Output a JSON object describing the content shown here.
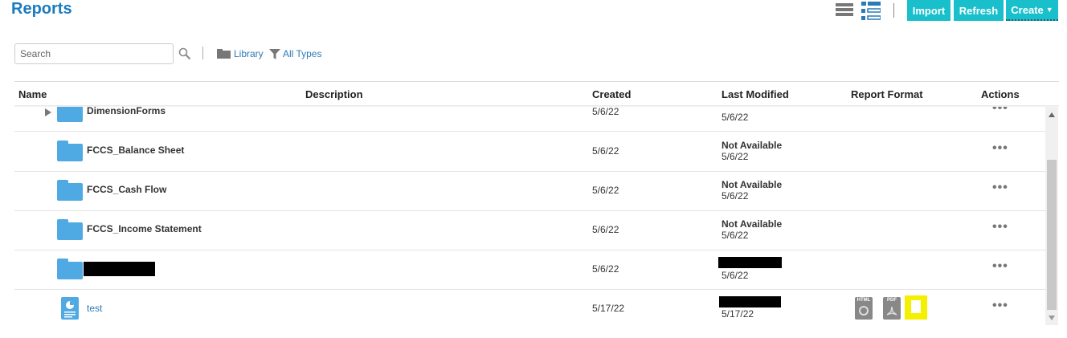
{
  "header": {
    "title": "Reports",
    "import_label": "Import",
    "refresh_label": "Refresh",
    "create_label": "Create",
    "accent": "#19c0cc"
  },
  "toolbar": {
    "search_placeholder": "Search",
    "library_label": "Library",
    "types_label": "All Types"
  },
  "columns": [
    "Name",
    "Description",
    "Created",
    "Last Modified",
    "Report Format",
    "Actions"
  ],
  "rows": [
    {
      "name": "DimensionForms",
      "created": "5/6/22",
      "modified_by": "",
      "modified_date": "5/6/22",
      "actions": "•••"
    },
    {
      "name": "FCCS_Balance Sheet",
      "created": "5/6/22",
      "modified_by": "Not Available",
      "modified_date": "5/6/22",
      "actions": "•••"
    },
    {
      "name": "FCCS_Cash Flow",
      "created": "5/6/22",
      "modified_by": "Not Available",
      "modified_date": "5/6/22",
      "actions": "•••"
    },
    {
      "name": "FCCS_Income Statement",
      "created": "5/6/22",
      "modified_by": "Not Available",
      "modified_date": "5/6/22",
      "actions": "•••"
    },
    {
      "name": "",
      "created": "5/6/22",
      "modified_by": "",
      "modified_date": "5/6/22",
      "actions": "•••"
    },
    {
      "name": "test",
      "created": "5/17/22",
      "modified_by": "",
      "modified_date": "5/17/22",
      "actions": "•••",
      "formats": [
        "HTML",
        "PDF"
      ]
    }
  ]
}
